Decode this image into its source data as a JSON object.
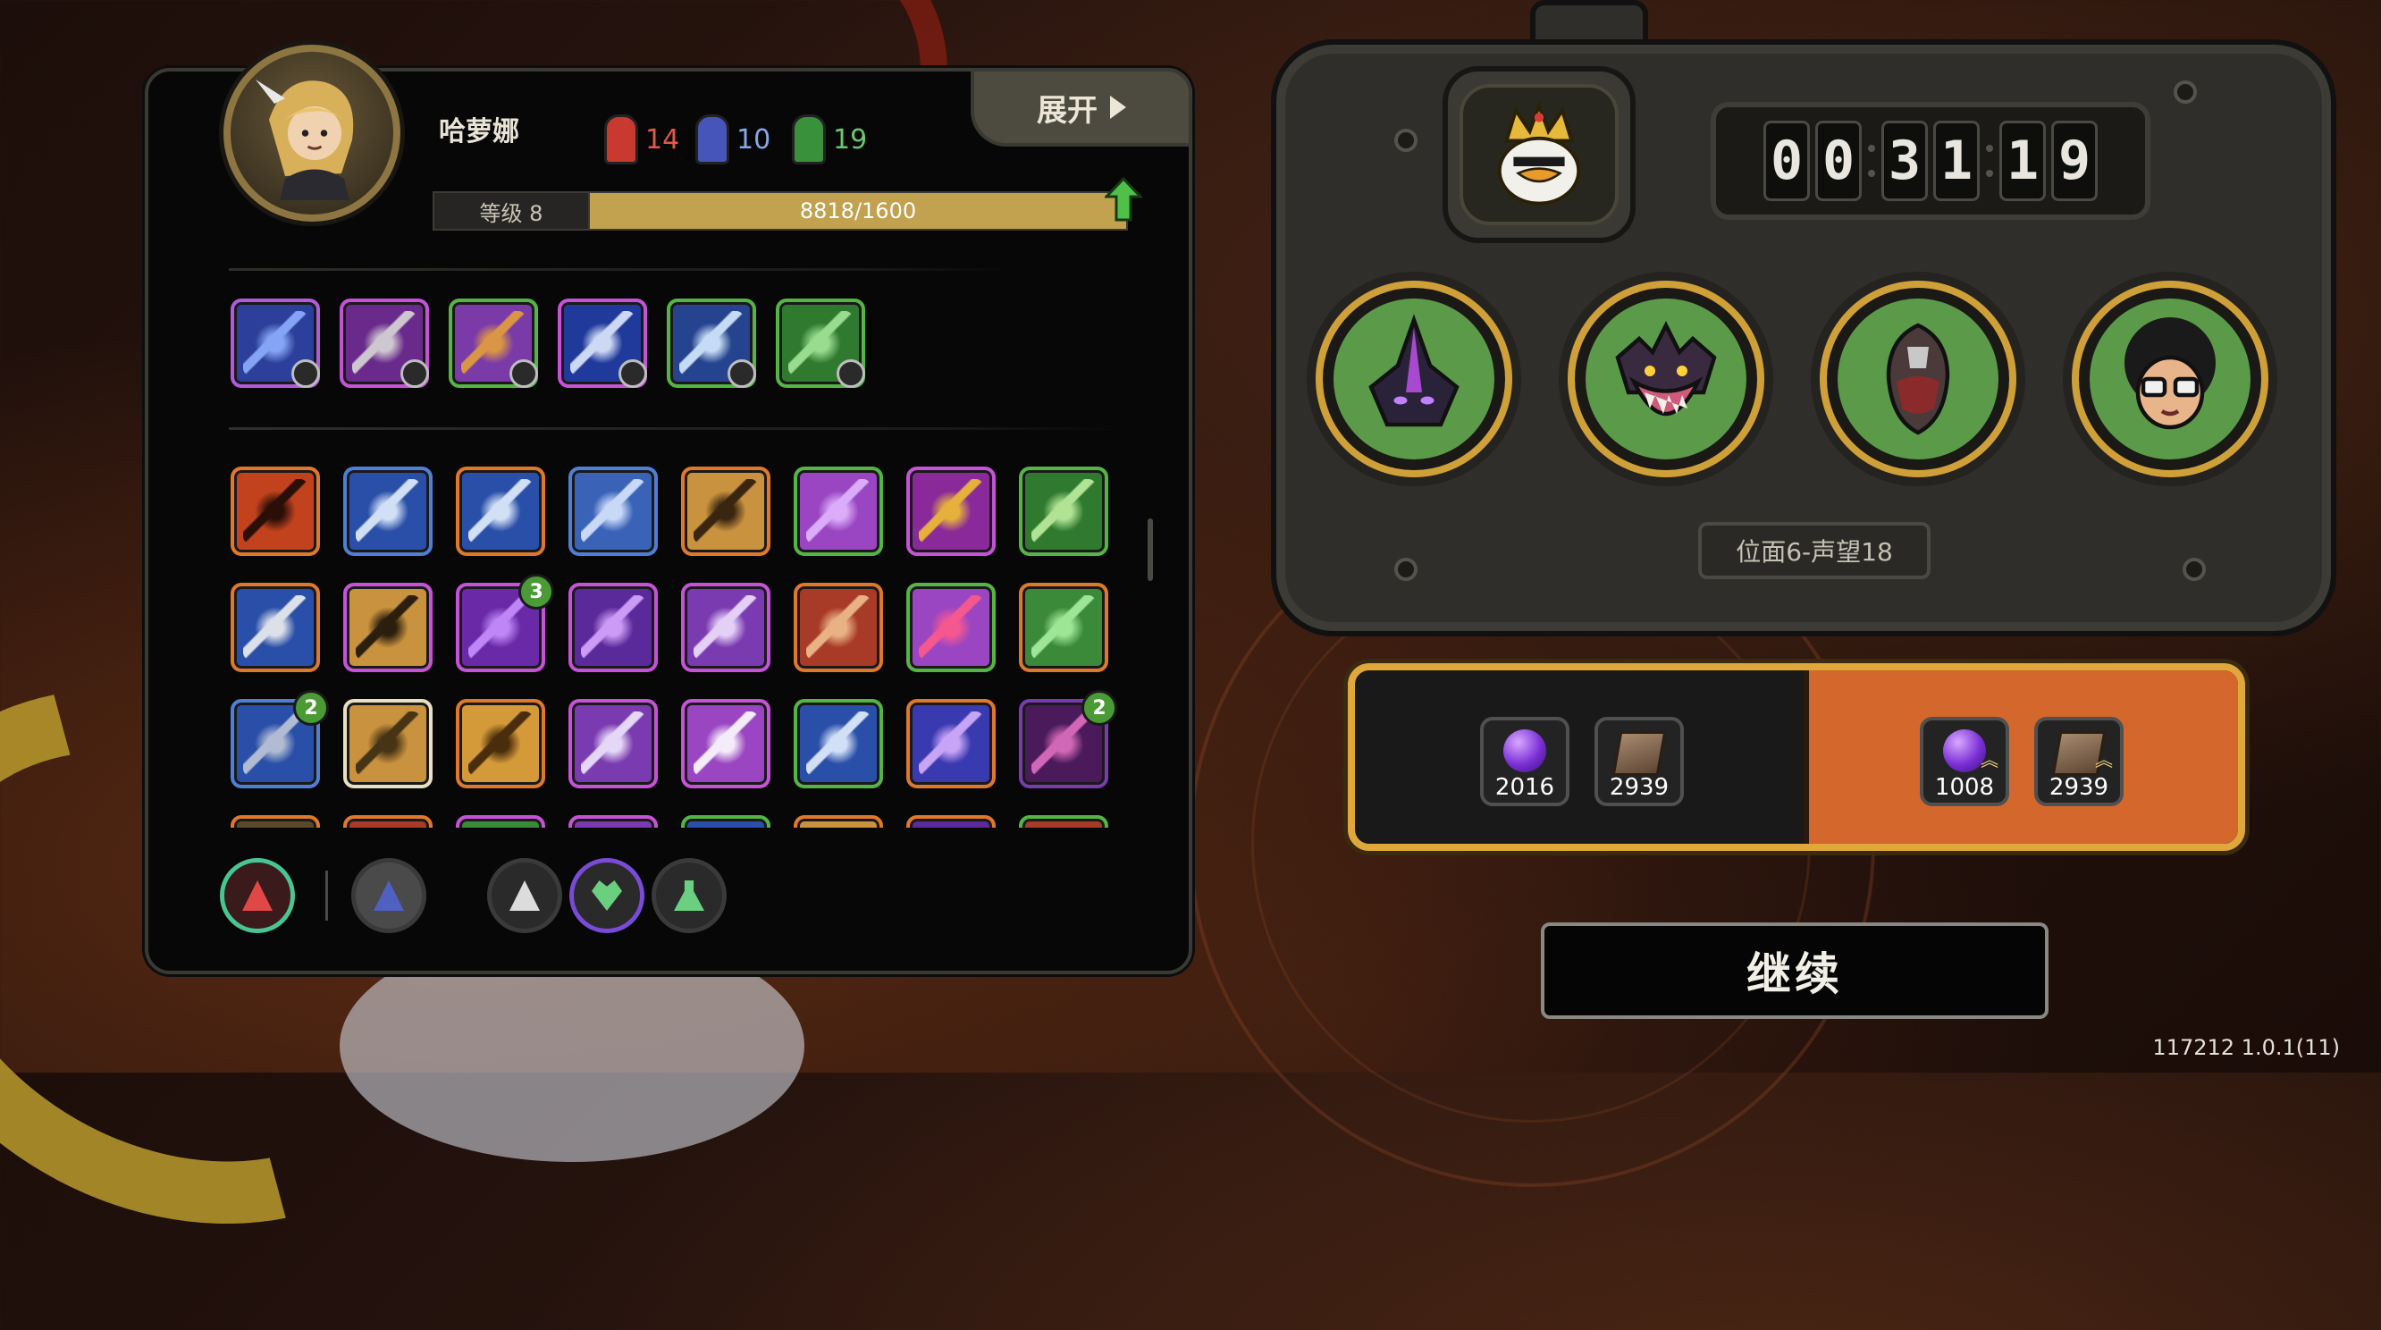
{
  "character": {
    "name": "哈萝娜",
    "stats": {
      "red": "14",
      "blue": "10",
      "green": "19"
    },
    "expand_label": "展开",
    "level_label": "等级 8",
    "xp_text": "8818/1600",
    "xp_fill_fraction": 1.0
  },
  "equipped_skills": [
    {
      "icon": "fist-skill-icon",
      "border": "#b15bd9",
      "bg": "#2c3f9a",
      "fg": "#8fb0ff"
    },
    {
      "icon": "crossed-swords-skill-icon",
      "border": "#c652d8",
      "bg": "#6a2a8c",
      "fg": "#d8d8d8"
    },
    {
      "icon": "triangle-shield-skill-icon",
      "border": "#55b544",
      "bg": "#7a3aa8",
      "fg": "#e5a13a"
    },
    {
      "icon": "lightning-strike-skill-icon",
      "border": "#c652d8",
      "bg": "#1f3a9a",
      "fg": "#e0eaff"
    },
    {
      "icon": "lightning-burst-skill-icon",
      "border": "#55b544",
      "bg": "#25438f",
      "fg": "#d8ecff"
    },
    {
      "icon": "leaf-burst-skill-icon",
      "border": "#55b544",
      "bg": "#2f7a2f",
      "fg": "#a5e69a"
    }
  ],
  "inventory": [
    {
      "icon": "demon-face-icon",
      "border": "#e0782c",
      "bg": "#c2421e",
      "fg": "#1a0a06"
    },
    {
      "icon": "electric-orb-icon",
      "border": "#4f7fd4",
      "bg": "#2a4fa8",
      "fg": "#e5f0ff"
    },
    {
      "icon": "running-figure-icon",
      "border": "#e0782c",
      "bg": "#2a4fa8",
      "fg": "#e5f0ff"
    },
    {
      "icon": "hand-gesture-icon",
      "border": "#4f7fd4",
      "bg": "#3a63b8",
      "fg": "#d8e6ff"
    },
    {
      "icon": "hooded-figure-icon",
      "border": "#e0782c",
      "bg": "#c9923f",
      "fg": "#2a1a0c"
    },
    {
      "icon": "purple-veins-icon",
      "border": "#55b544",
      "bg": "#9a46c2",
      "fg": "#e2b8ff"
    },
    {
      "icon": "thunder-bolt-icon",
      "border": "#c652d8",
      "bg": "#8a2a9a",
      "fg": "#f0c030"
    },
    {
      "icon": "green-diamond-icon",
      "border": "#55b544",
      "bg": "#2f7a2f",
      "fg": "#bff0a0"
    },
    {
      "icon": "white-claws-icon",
      "border": "#e0782c",
      "bg": "#2a4fa8",
      "fg": "#f0f0f0"
    },
    {
      "icon": "dark-drone-icon",
      "border": "#c652d8",
      "bg": "#c9923f",
      "fg": "#1a1208"
    },
    {
      "icon": "spiky-orb-icon",
      "border": "#c652d8",
      "bg": "#6a2aa8",
      "fg": "#c890ff",
      "badge": "3"
    },
    {
      "icon": "melting-skull-icon",
      "border": "#c652d8",
      "bg": "#5a2a9a",
      "fg": "#d8a8ff"
    },
    {
      "icon": "shattered-purple-icon",
      "border": "#c652d8",
      "bg": "#7a3ab0",
      "fg": "#f0e0ff"
    },
    {
      "icon": "claw-slash-icon",
      "border": "#e0782c",
      "bg": "#a83a28",
      "fg": "#f0c090"
    },
    {
      "icon": "warning-triangle-icon",
      "border": "#55b544",
      "bg": "#9a46c2",
      "fg": "#ff5a8a"
    },
    {
      "icon": "green-vortex-icon",
      "border": "#e0782c",
      "bg": "#3a8a3a",
      "fg": "#a8f0a0"
    },
    {
      "icon": "serpent-icon",
      "border": "#4f7fd4",
      "bg": "#2a4fa8",
      "fg": "#c0c8d8",
      "badge": "2"
    },
    {
      "icon": "golden-ruins-icon",
      "border": "#e8e0c0",
      "bg": "#c9923f",
      "fg": "#3a2a10"
    },
    {
      "icon": "spike-cluster-icon",
      "border": "#e0782c",
      "bg": "#d49a3a",
      "fg": "#3a2208"
    },
    {
      "icon": "purple-spire-icon",
      "border": "#c652d8",
      "bg": "#7a3ab0",
      "fg": "#f0e8ff"
    },
    {
      "icon": "white-mask-icon",
      "border": "#c652d8",
      "bg": "#9a46c2",
      "fg": "#ffffff"
    },
    {
      "icon": "ice-waterfall-icon",
      "border": "#55b544",
      "bg": "#2a4fa8",
      "fg": "#e5f0ff"
    },
    {
      "icon": "violet-blade-icon",
      "border": "#e0782c",
      "bg": "#3a3ab0",
      "fg": "#d8b0ff"
    },
    {
      "icon": "spine-column-icon",
      "border": "#7a3ab0",
      "bg": "#4a1a5a",
      "fg": "#e070c0",
      "badge": "2"
    },
    {
      "icon": "golden-item-icon",
      "border": "#e0782c",
      "bg": "#5a4a2a",
      "fg": "#d8b050"
    },
    {
      "icon": "red-slash-icon",
      "border": "#e0782c",
      "bg": "#a83a28",
      "fg": "#f0d0a0"
    },
    {
      "icon": "green-leaf-icon",
      "border": "#c652d8",
      "bg": "#3a8a3a",
      "fg": "#a8f0a0"
    },
    {
      "icon": "violet-swirl-icon",
      "border": "#c652d8",
      "bg": "#7a3ab0",
      "fg": "#f0c0ff"
    },
    {
      "icon": "blue-crystal-icon",
      "border": "#55b544",
      "bg": "#2a4fa8",
      "fg": "#e5f0ff"
    },
    {
      "icon": "bone-pile-icon",
      "border": "#e0782c",
      "bg": "#c9923f",
      "fg": "#f0e0c0"
    },
    {
      "icon": "purple-gem-icon",
      "border": "#e0782c",
      "bg": "#5a2a9a",
      "fg": "#d8a8ff"
    },
    {
      "icon": "horned-mask-icon",
      "border": "#55b544",
      "bg": "#a83a28",
      "fg": "#ffd0d0"
    }
  ],
  "bottom_bar": [
    {
      "icon": "red-demon-emblem-icon",
      "ring": "#49c493",
      "fill": "#3a1a1a",
      "fg": "#e04848"
    },
    {
      "icon": "spiked-mace-icon",
      "ring": "#3a3a3a",
      "fill": "#4a4a4a",
      "fg": "#5060c0"
    },
    {
      "icon": "triangle-rune-icon",
      "ring": "#3a3a3a",
      "fill": "#2a2a2a",
      "fg": "#dcdcdc"
    },
    {
      "icon": "heart-rune-icon",
      "ring": "#7a4ad8",
      "fill": "#2a2a2a",
      "fg": "#6ad080"
    },
    {
      "icon": "potion-flask-icon",
      "ring": "#3a3a3a",
      "fill": "#2a2a2a",
      "fg": "#6ad080"
    }
  ],
  "timer": {
    "digits": [
      "0",
      "0",
      "3",
      "1",
      "1",
      "9"
    ]
  },
  "bosses": [
    {
      "icon": "hooded-wraith-boss-icon"
    },
    {
      "icon": "crowned-horror-boss-icon"
    },
    {
      "icon": "armored-beetle-boss-icon"
    },
    {
      "icon": "afro-glasses-boss-icon"
    }
  ],
  "plane_label": "位面6-声望18",
  "rewards": {
    "left": [
      {
        "icon": "purple-orb-icon",
        "value": "2016"
      },
      {
        "icon": "tome-icon",
        "value": "2939"
      }
    ],
    "right": [
      {
        "icon": "purple-orb-upgrade-icon",
        "value": "1008"
      },
      {
        "icon": "tome-upgrade-icon",
        "value": "2939"
      }
    ]
  },
  "continue_label": "继续",
  "version": "117212 1.0.1(11)"
}
